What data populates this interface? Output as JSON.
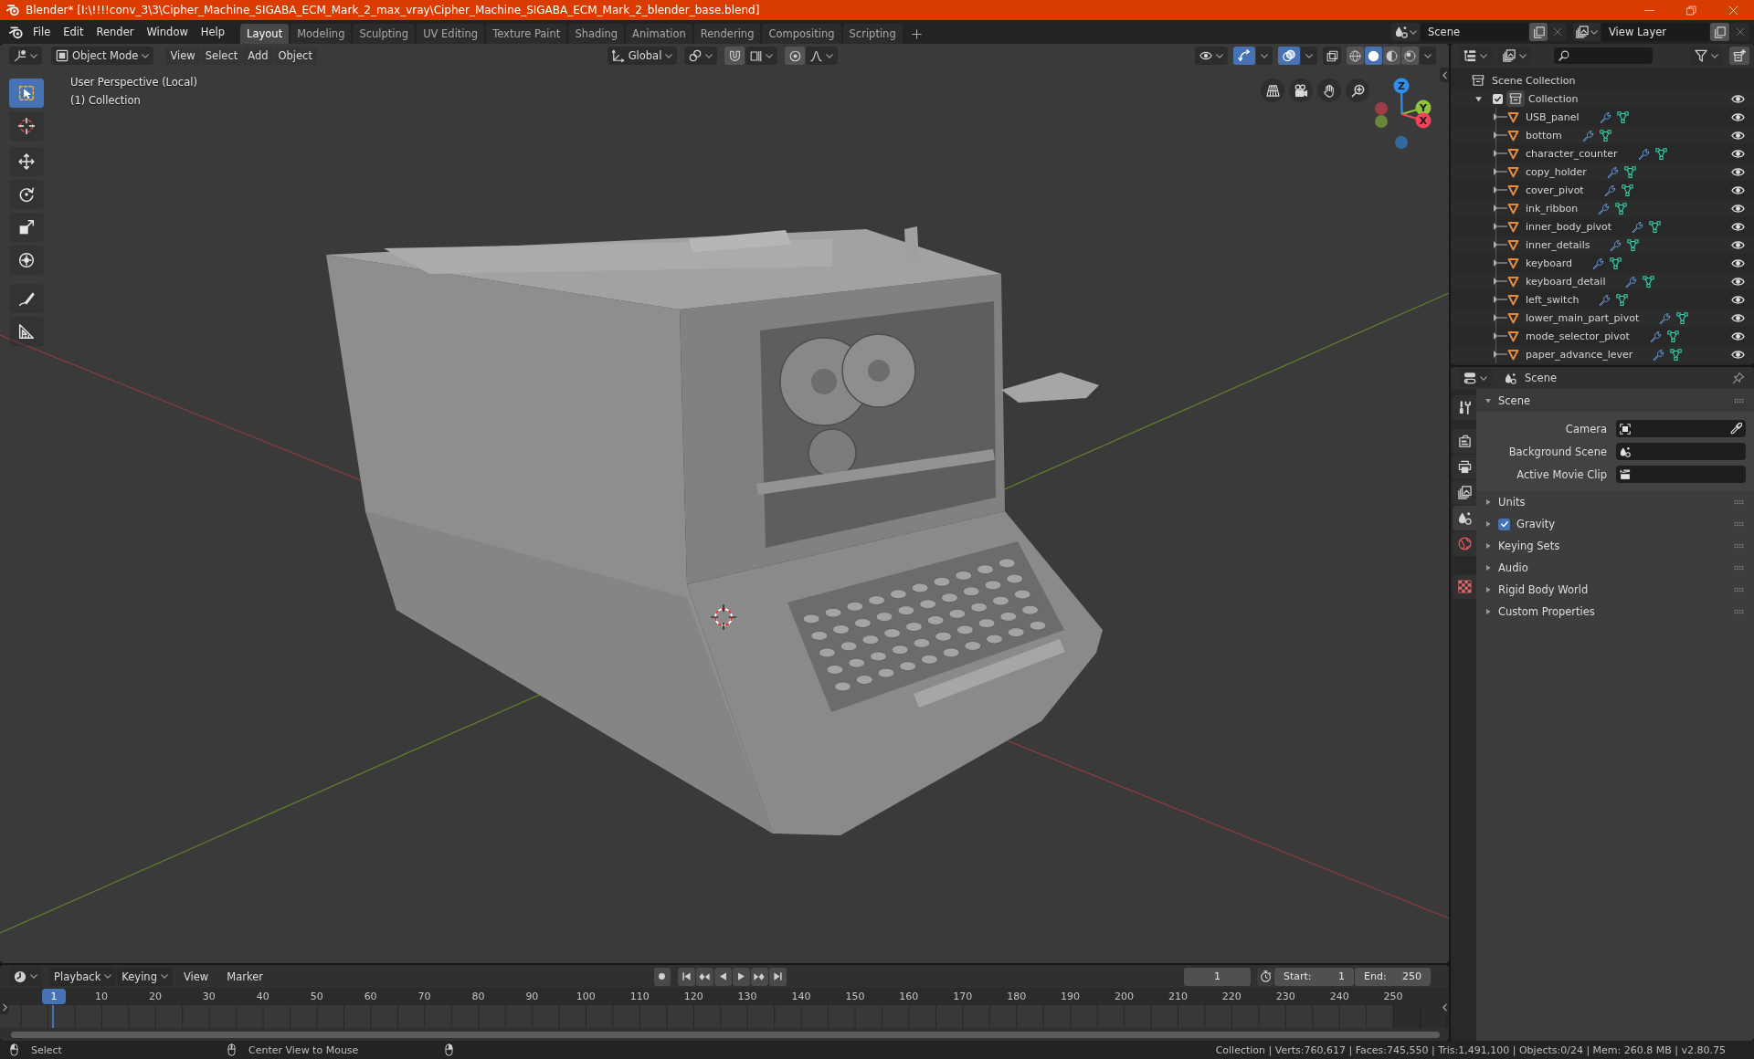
{
  "window": {
    "title": "Blender* [I:\\!!!!conv_3\\3\\Cipher_Machine_SIGABA_ECM_Mark_2_max_vray\\Cipher_Machine_SIGABA_ECM_Mark_2_blender_base.blend]"
  },
  "menu": [
    "File",
    "Edit",
    "Render",
    "Window",
    "Help"
  ],
  "workspaces": [
    {
      "label": "Layout",
      "selected": true
    },
    {
      "label": "Modeling",
      "selected": false
    },
    {
      "label": "Sculpting",
      "selected": false
    },
    {
      "label": "UV Editing",
      "selected": false
    },
    {
      "label": "Texture Paint",
      "selected": false
    },
    {
      "label": "Shading",
      "selected": false
    },
    {
      "label": "Animation",
      "selected": false
    },
    {
      "label": "Rendering",
      "selected": false
    },
    {
      "label": "Compositing",
      "selected": false
    },
    {
      "label": "Scripting",
      "selected": false
    }
  ],
  "scene": {
    "value": "Scene"
  },
  "view_layer": {
    "value": "View Layer"
  },
  "viewport": {
    "mode": "Object Mode",
    "menus": [
      "View",
      "Select",
      "Add",
      "Object"
    ],
    "orientation": "Global",
    "gizmos": {
      "on": true
    },
    "overlays": {
      "on": true
    },
    "xray": {
      "on": false
    },
    "shading": [
      {
        "kind": "wireframe",
        "selected": false
      },
      {
        "kind": "solid",
        "selected": true
      },
      {
        "kind": "material",
        "selected": false
      },
      {
        "kind": "rendered",
        "selected": false
      }
    ],
    "info": [
      "User Perspective (Local)",
      "(1) Collection"
    ],
    "tools": [
      {
        "kind": "select_box",
        "selected": true
      },
      {
        "kind": "cursor",
        "selected": false
      },
      {
        "kind": "move",
        "selected": false
      },
      {
        "kind": "rotate",
        "selected": false
      },
      {
        "kind": "scale",
        "selected": false
      },
      {
        "kind": "transform",
        "selected": false
      },
      {
        "kind": "annotate",
        "selected": false
      },
      {
        "kind": "measure",
        "selected": false
      }
    ],
    "gizmo": [
      {
        "label": "Z",
        "color": "#2f8ff0"
      },
      {
        "label": "Y",
        "color": "#8cc43a"
      },
      {
        "label": "X",
        "color": "#f5405a"
      }
    ]
  },
  "outliner": {
    "root": "Scene Collection",
    "collections": [
      {
        "name": "Collection",
        "checked": true,
        "expanded": true,
        "visible": true,
        "children": [
          {
            "name": "USB_panel",
            "expanded": false,
            "visible": true
          },
          {
            "name": "bottom",
            "expanded": false,
            "visible": true
          },
          {
            "name": "character_counter",
            "expanded": false,
            "visible": true
          },
          {
            "name": "copy_holder",
            "expanded": false,
            "visible": true
          },
          {
            "name": "cover_pivot",
            "expanded": false,
            "visible": true
          },
          {
            "name": "ink_ribbon",
            "expanded": false,
            "visible": true
          },
          {
            "name": "inner_body_pivot",
            "expanded": false,
            "visible": true
          },
          {
            "name": "inner_details",
            "expanded": false,
            "visible": true
          },
          {
            "name": "keyboard",
            "expanded": false,
            "visible": true
          },
          {
            "name": "keyboard_detail",
            "expanded": false,
            "visible": true
          },
          {
            "name": "left_switch",
            "expanded": false,
            "visible": true
          },
          {
            "name": "lower_main_part_pivot",
            "expanded": false,
            "visible": true
          },
          {
            "name": "mode_selector_pivot",
            "expanded": false,
            "visible": true
          },
          {
            "name": "paper_advance_lever",
            "expanded": false,
            "visible": true
          }
        ]
      }
    ]
  },
  "properties": {
    "context": "Scene",
    "tabs": [
      {
        "kind": "tool",
        "selected": false
      },
      {
        "kind": "render",
        "selected": false
      },
      {
        "kind": "output",
        "selected": false
      },
      {
        "kind": "view_layer",
        "selected": false
      },
      {
        "kind": "scene",
        "selected": true
      },
      {
        "kind": "world",
        "selected": false
      },
      {
        "kind": "texture",
        "selected": false
      }
    ],
    "panels": [
      {
        "title": "Scene",
        "kind": "plain",
        "expanded": true,
        "fields": [
          {
            "label": "Camera",
            "kind": "camera"
          },
          {
            "label": "Background Scene",
            "kind": "scene"
          },
          {
            "label": "Active Movie Clip",
            "kind": "clip"
          }
        ]
      },
      {
        "title": "Units",
        "kind": "plain",
        "expanded": false
      },
      {
        "title": "Gravity",
        "kind": "toggle",
        "expanded": false,
        "checked": true
      },
      {
        "title": "Keying Sets",
        "kind": "plain",
        "expanded": false
      },
      {
        "title": "Audio",
        "kind": "plain",
        "expanded": false
      },
      {
        "title": "Rigid Body World",
        "kind": "plain",
        "expanded": false
      },
      {
        "title": "Custom Properties",
        "kind": "plain",
        "expanded": false
      }
    ]
  },
  "timeline": {
    "menus": [
      {
        "label": "Playback",
        "kind": "dropdown"
      },
      {
        "label": "Keying",
        "kind": "dropdown"
      },
      {
        "label": "View",
        "kind": "menu"
      },
      {
        "label": "Marker",
        "kind": "menu"
      }
    ],
    "frame": "1",
    "start": {
      "label": "Start:",
      "value": "1"
    },
    "end": {
      "label": "End:",
      "value": "250"
    },
    "playhead": "1",
    "ruler": [
      "10",
      "20",
      "30",
      "40",
      "50",
      "60",
      "70",
      "80",
      "90",
      "100",
      "110",
      "120",
      "130",
      "140",
      "150",
      "160",
      "170",
      "180",
      "190",
      "200",
      "210",
      "220",
      "230",
      "240",
      "250"
    ]
  },
  "status_bar": {
    "hints": [
      {
        "kind": "left",
        "label": "Select"
      },
      {
        "kind": "middle",
        "label": "Center View to Mouse"
      },
      {
        "kind": "right"
      }
    ],
    "stats": "Collection | Verts:760,617 | Faces:745,550 | Tris:1,491,100 | Objects:0/24 | Mem: 260.8 MB | v2.80.75"
  }
}
